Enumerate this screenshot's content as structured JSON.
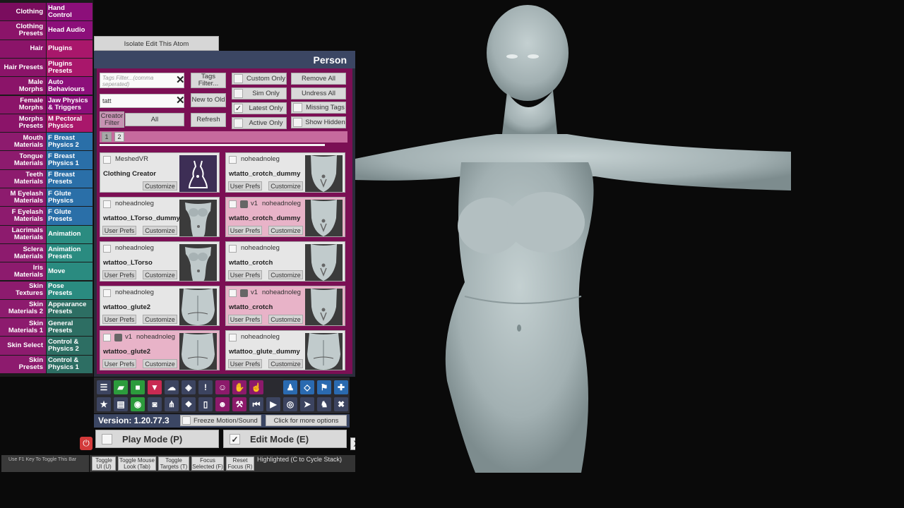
{
  "tabs_left": [
    [
      "Clothing"
    ],
    [
      "Clothing",
      "Presets"
    ],
    [
      "Hair"
    ],
    [
      "Hair Presets"
    ],
    [
      "Male",
      "Morphs"
    ],
    [
      "Female",
      "Morphs"
    ],
    [
      "Morphs",
      "Presets"
    ],
    [
      "Mouth",
      "Materials"
    ],
    [
      "Tongue",
      "Materials"
    ],
    [
      "Teeth",
      "Materials"
    ],
    [
      "M Eyelash",
      "Materials"
    ],
    [
      "F Eyelash",
      "Materials"
    ],
    [
      "Lacrimals",
      "Materials"
    ],
    [
      "Sclera",
      "Materials"
    ],
    [
      "Iris",
      "Materials"
    ],
    [
      "Skin",
      "Textures"
    ],
    [
      "Skin",
      "Materials 2"
    ],
    [
      "Skin",
      "Materials 1"
    ],
    [
      "Skin Select"
    ],
    [
      "Skin",
      "Presets"
    ]
  ],
  "tabs_right": [
    [
      "Hand",
      "Control"
    ],
    [
      "Head Audio"
    ],
    [
      "Plugins"
    ],
    [
      "Plugins",
      "Presets"
    ],
    [
      "Auto",
      "Behaviours"
    ],
    [
      "Jaw Physics",
      "& Triggers"
    ],
    [
      "M Pectoral",
      "Physics"
    ],
    [
      "F Breast",
      "Physics 2"
    ],
    [
      "F Breast",
      "Physics 1"
    ],
    [
      "F Breast",
      "Presets"
    ],
    [
      "F Glute",
      "Physics"
    ],
    [
      "F Glute",
      "Presets"
    ],
    [
      "Animation"
    ],
    [
      "Animation",
      "Presets"
    ],
    [
      "Move"
    ],
    [
      "Pose",
      "Presets"
    ],
    [
      "Appearance",
      "Presets"
    ],
    [
      "General",
      "Presets"
    ],
    [
      "Control &",
      "Physics 2"
    ],
    [
      "Control &",
      "Physics 1"
    ]
  ],
  "isolate_label": "Isolate Edit This Atom",
  "panel": {
    "title": "Person",
    "tags_placeholder": "Tags Filter...(comma seperated)",
    "search_value": "tatt",
    "tags_filter_btn": "Tags Filter...",
    "sort_btn": "New to Old",
    "refresh_btn": "Refresh",
    "creator_filter_label": "Creator Filter",
    "creator_filter_value": "All",
    "toggles": [
      {
        "label": "Custom Only",
        "checked": false
      },
      {
        "label": "Sim Only",
        "checked": false
      },
      {
        "label": "Latest Only",
        "checked": true
      },
      {
        "label": "Active Only",
        "checked": false
      }
    ],
    "remove_all": "Remove All",
    "undress_all": "Undress All",
    "missing_tags": "Missing Tags",
    "show_hidden": "Show Hidden",
    "pages": [
      "1",
      "2"
    ],
    "progress": 0.91,
    "user_prefs_label": "User Prefs",
    "customize_label": "Customize",
    "items": [
      {
        "creator": "MeshedVR",
        "name": "Clothing Creator",
        "version": "",
        "pink": false,
        "prefs": false,
        "thumb": "dress"
      },
      {
        "creator": "noheadnoleg",
        "name": "wtatto_crotch_dummy",
        "version": "",
        "pink": false,
        "prefs": true,
        "thumb": "hips"
      },
      {
        "creator": "noheadnoleg",
        "name": "wtattoo_LTorso_dummy",
        "version": "",
        "pink": false,
        "prefs": true,
        "thumb": "torso"
      },
      {
        "creator": "noheadnoleg",
        "name": "wtatto_crotch_dummy",
        "version": "v1",
        "pink": true,
        "prefs": true,
        "thumb": "hips"
      },
      {
        "creator": "noheadnoleg",
        "name": "wtattoo_LTorso",
        "version": "",
        "pink": false,
        "prefs": true,
        "thumb": "torso"
      },
      {
        "creator": "noheadnoleg",
        "name": "wtatto_crotch",
        "version": "",
        "pink": false,
        "prefs": true,
        "thumb": "hips"
      },
      {
        "creator": "noheadnoleg",
        "name": "wtattoo_glute2",
        "version": "",
        "pink": false,
        "prefs": true,
        "thumb": "glute"
      },
      {
        "creator": "noheadnoleg",
        "name": "wtatto_crotch",
        "version": "v1",
        "pink": true,
        "prefs": true,
        "thumb": "hips"
      },
      {
        "creator": "noheadnoleg",
        "name": "wtattoo_glute2",
        "version": "v1",
        "pink": true,
        "prefs": true,
        "thumb": "glute"
      },
      {
        "creator": "noheadnoleg",
        "name": "wtattoo_glute_dummy",
        "version": "",
        "pink": false,
        "prefs": true,
        "thumb": "glute"
      }
    ]
  },
  "toolbar_row1": [
    {
      "icon": "menu-icon",
      "c": "dk"
    },
    {
      "icon": "folder-open-icon",
      "c": "gr"
    },
    {
      "icon": "folder-icon",
      "c": "gr"
    },
    {
      "icon": "save-icon",
      "c": "rd"
    },
    {
      "icon": "cloud-icon",
      "c": "dk"
    },
    {
      "icon": "package-icon",
      "c": "dk"
    },
    {
      "icon": "alert-icon",
      "c": "dk"
    },
    {
      "icon": "person-add-icon",
      "c": "mg"
    },
    {
      "icon": "hand-icon",
      "c": "mg"
    },
    {
      "icon": "pointer-hand-icon",
      "c": "mg"
    },
    {
      "icon": "person-icon",
      "c": "bl"
    },
    {
      "icon": "unity-icon",
      "c": "bl"
    },
    {
      "icon": "flag-icon",
      "c": "bl"
    },
    {
      "icon": "plus-icon",
      "c": "bl"
    }
  ],
  "toolbar_row2": [
    {
      "icon": "star-icon",
      "c": "dk"
    },
    {
      "icon": "load-scene-icon",
      "c": "dk"
    },
    {
      "icon": "screenshot-icon",
      "c": "gr"
    },
    {
      "icon": "camera-icon",
      "c": "dk"
    },
    {
      "icon": "graph-icon",
      "c": "dk"
    },
    {
      "icon": "dropbox-icon",
      "c": "dk"
    },
    {
      "icon": "document-icon",
      "c": "dk"
    },
    {
      "icon": "person-remove-icon",
      "c": "mg"
    },
    {
      "icon": "wrench-person-icon",
      "c": "mg"
    },
    {
      "icon": "skip-back-icon",
      "c": "dk"
    },
    {
      "icon": "play-icon",
      "c": "dk"
    },
    {
      "icon": "target-icon",
      "c": "dk"
    },
    {
      "icon": "cursor-icon",
      "c": "dk"
    },
    {
      "icon": "people-icon",
      "c": "dk"
    },
    {
      "icon": "tools-icon",
      "c": "dk"
    }
  ],
  "version": "Version: 1.20.77.3",
  "freeze_label": "Freeze Motion/Sound",
  "more_options": "Click for more options",
  "play_mode": "Play Mode (P)",
  "edit_mode": "Edit Mode (E)",
  "edit_checked": "✓",
  "close_x": "X",
  "f1_hint": "Use F1 Key To Toggle This Bar",
  "bottom_buttons": [
    {
      "l1": "Toggle",
      "l2": "UI (U)"
    },
    {
      "l1": "Toggle Mouse",
      "l2": "Look (Tab)"
    },
    {
      "l1": "Toggle",
      "l2": "Targets (T)"
    },
    {
      "l1": "Focus",
      "l2": "Selected (F)"
    },
    {
      "l1": "Reset",
      "l2": "Focus (R)"
    }
  ],
  "highlighted": "Highlighted (C to Cycle Stack)",
  "colors": {
    "tab_magenta": "#8c0f7a",
    "tab_pink": "#a9176b",
    "tab_purple": "#8e1b8e",
    "tab_blue": "#2a6fa8",
    "tab_teal": "#2a8b80",
    "tab_darkteal": "#2d6e63",
    "panel_bg": "#7b0f54",
    "figure": "#a7b4b6"
  }
}
